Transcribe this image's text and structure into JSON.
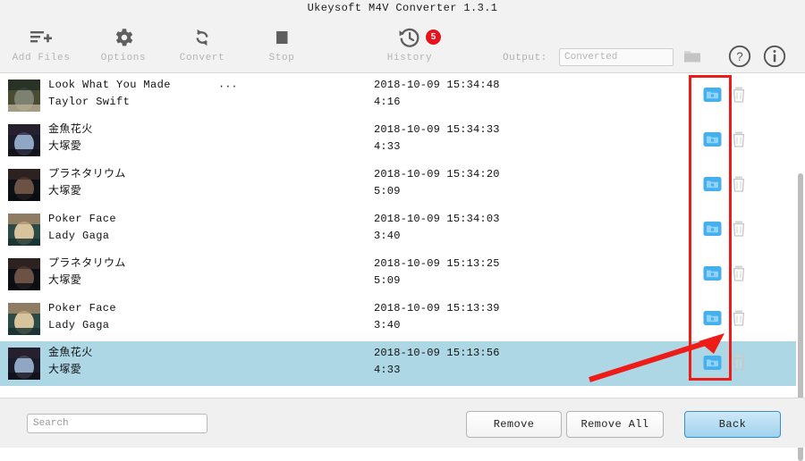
{
  "window": {
    "title": "Ukeysoft M4V Converter 1.3.1"
  },
  "toolbar": {
    "buttons": [
      {
        "label": "Add Files",
        "icon": "add-files-icon"
      },
      {
        "label": "Options",
        "icon": "gear-icon"
      },
      {
        "label": "Convert",
        "icon": "refresh-icon"
      },
      {
        "label": "Stop",
        "icon": "stop-square-icon"
      },
      {
        "label": "History",
        "icon": "history-clock-icon"
      }
    ],
    "history_badge": "5",
    "output_label": "Output:",
    "output_value": "",
    "output_placeholder": "Converted",
    "browse_icon": "folder-icon",
    "help_icon": "question-mark-icon",
    "info_icon": "info-icon"
  },
  "list": {
    "rows": [
      {
        "title": "Look What You Made",
        "title_suffix": "···",
        "artist": "Taylor Swift",
        "date": "2018-10-09 15:34:48",
        "duration": "4:16",
        "selected": false,
        "thumb_colors": [
          "#4a4b33",
          "#7d8170",
          "#1d2a22",
          "#b9b096"
        ]
      },
      {
        "title": "金魚花火",
        "title_suffix": "",
        "artist": "大塚愛",
        "date": "2018-10-09 15:34:33",
        "duration": "4:33",
        "selected": false,
        "thumb_colors": [
          "#1a1c2a",
          "#8fa7c4",
          "#2a2030",
          "#121018"
        ]
      },
      {
        "title": "プラネタリウム",
        "title_suffix": "",
        "artist": "大塚愛",
        "date": "2018-10-09 15:34:20",
        "duration": "5:09",
        "selected": false,
        "thumb_colors": [
          "#0d0f16",
          "#6b5244",
          "#3a2a24",
          "#0a0c12"
        ]
      },
      {
        "title": "Poker Face",
        "title_suffix": "",
        "artist": "Lady Gaga",
        "date": "2018-10-09 15:34:03",
        "duration": "3:40",
        "selected": false,
        "thumb_colors": [
          "#2c4a45",
          "#d8c49c",
          "#b08f6e",
          "#17302f"
        ]
      },
      {
        "title": "プラネタリウム",
        "title_suffix": "",
        "artist": "大塚愛",
        "date": "2018-10-09 15:13:25",
        "duration": "5:09",
        "selected": false,
        "thumb_colors": [
          "#0d0f16",
          "#6b5244",
          "#3a2a24",
          "#0a0c12"
        ]
      },
      {
        "title": "Poker Face",
        "title_suffix": "",
        "artist": "Lady Gaga",
        "date": "2018-10-09 15:13:39",
        "duration": "3:40",
        "selected": false,
        "thumb_colors": [
          "#2c4a45",
          "#d8c49c",
          "#b08f6e",
          "#17302f"
        ]
      },
      {
        "title": "金魚花火",
        "title_suffix": "",
        "artist": "大塚愛",
        "date": "2018-10-09 15:13:56",
        "duration": "4:33",
        "selected": true,
        "thumb_colors": [
          "#1a1c2a",
          "#8fa7c4",
          "#2a2030",
          "#121018"
        ]
      }
    ],
    "row_open_icon": "open-folder-icon",
    "row_delete_icon": "trash-icon"
  },
  "bottom": {
    "search_value": "",
    "search_placeholder": "Search",
    "remove_label": "Remove",
    "remove_all_label": "Remove All",
    "back_label": "Back"
  },
  "annotations": {
    "highlight_color": "#ee1c18",
    "arrow_color": "#ee1c18"
  },
  "colors": {
    "selected_row": "#aed7e5",
    "folder_icon": "#46b0ef",
    "badge": "#e8131a",
    "toolbar_bg": "#f2f2f2",
    "back_button": "#9fd2ef"
  }
}
